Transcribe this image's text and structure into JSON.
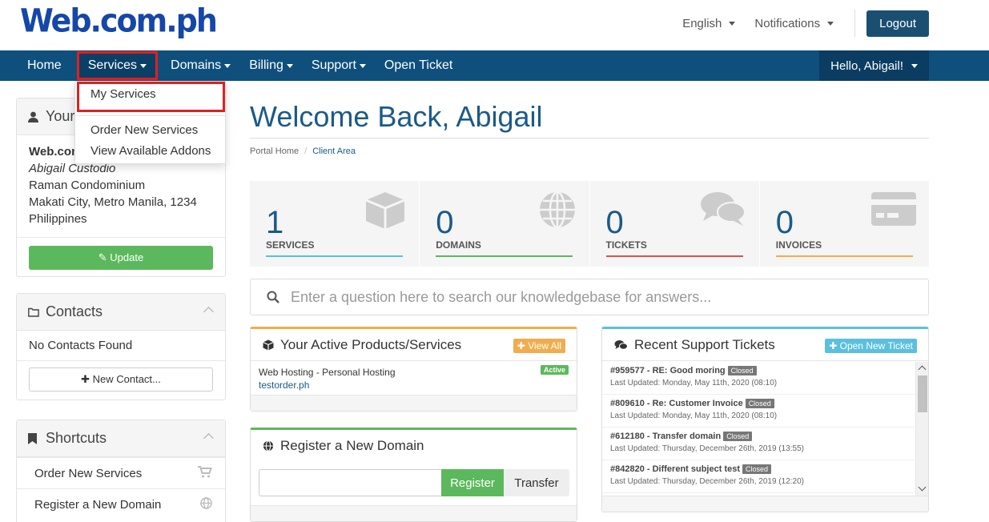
{
  "header": {
    "logo": "Web.com.ph",
    "language": "English",
    "notifications": "Notifications",
    "logout": "Logout"
  },
  "nav": {
    "items": [
      "Home",
      "Services",
      "Domains",
      "Billing",
      "Support",
      "Open Ticket"
    ],
    "greeting": "Hello, Abigail!"
  },
  "services_dropdown": {
    "items": [
      "My Services",
      "Order New Services",
      "View Available Addons"
    ]
  },
  "your_info": {
    "title": "Your",
    "company": "Web.com",
    "name": "Abigail Custodio",
    "address1": "Raman Condominium",
    "address2": "Makati City, Metro Manila, 1234",
    "country": "Philippines",
    "update_button": "Update"
  },
  "contacts": {
    "title": "Contacts",
    "empty": "No Contacts Found",
    "new_button": "New Contact..."
  },
  "shortcuts": {
    "title": "Shortcuts",
    "items": [
      "Order New Services",
      "Register a New Domain"
    ]
  },
  "main": {
    "welcome": "Welcome Back, Abigail",
    "breadcrumb_home": "Portal Home",
    "breadcrumb_current": "Client Area"
  },
  "stats": [
    {
      "value": "1",
      "label": "SERVICES",
      "color": "#5bc0de"
    },
    {
      "value": "0",
      "label": "DOMAINS",
      "color": "#5cb85c"
    },
    {
      "value": "0",
      "label": "TICKETS",
      "color": "#d9534f"
    },
    {
      "value": "0",
      "label": "INVOICES",
      "color": "#f0ad4e"
    }
  ],
  "kb_search": {
    "placeholder": "Enter a question here to search our knowledgebase for answers..."
  },
  "products": {
    "title": "Your Active Products/Services",
    "view_all": "View All",
    "service_name": "Web Hosting - Personal Hosting",
    "service_domain": "testorder.ph",
    "status": "Active"
  },
  "register_domain": {
    "title": "Register a New Domain",
    "register": "Register",
    "transfer": "Transfer"
  },
  "tickets": {
    "title": "Recent Support Tickets",
    "open_new": "Open New Ticket",
    "items": [
      {
        "title": "#959577 - RE: Good moring",
        "status": "Closed",
        "updated": "Last Updated: Monday, May 11th, 2020 (08:10)"
      },
      {
        "title": "#809610 - Re: Customer Invoice",
        "status": "Closed",
        "updated": "Last Updated: Monday, May 11th, 2020 (08:10)"
      },
      {
        "title": "#612180 - Transfer domain",
        "status": "Closed",
        "updated": "Last Updated: Thursday, December 26th, 2019 (13:55)"
      },
      {
        "title": "#842820 - Different subject test",
        "status": "Closed",
        "updated": "Last Updated: Thursday, December 26th, 2019 (12:20)"
      }
    ]
  }
}
